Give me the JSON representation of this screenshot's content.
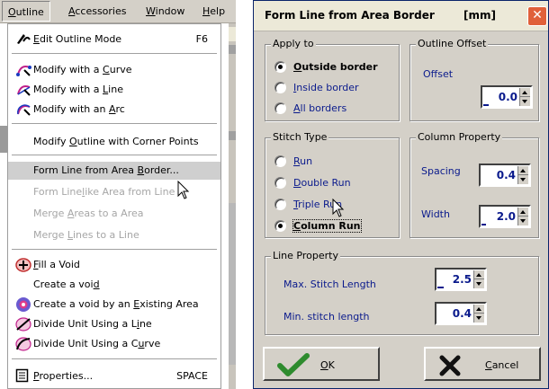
{
  "menubar": {
    "items": [
      {
        "label": "Outline",
        "ul": "O",
        "rest": "utline",
        "active": true
      },
      {
        "label": "Accessories",
        "ul": "A",
        "rest": "ccessories"
      },
      {
        "label": "Window",
        "ul": "W",
        "rest": "indow"
      },
      {
        "label": "Help",
        "ul": "H",
        "rest": "elp"
      }
    ]
  },
  "menu": {
    "edit_mode": {
      "pre": "",
      "ul": "E",
      "post": "dit Outline Mode",
      "shortcut": "F6",
      "icon": "edit-outline-icon"
    },
    "modify_curve": {
      "pre": "Modify with a ",
      "ul": "C",
      "post": "urve",
      "icon": "curve-modify-icon"
    },
    "modify_line": {
      "pre": "Modify with a ",
      "ul": "L",
      "post": "ine",
      "icon": "line-modify-icon"
    },
    "modify_arc": {
      "pre": "Modify with an ",
      "ul": "A",
      "post": "rc",
      "icon": "arc-modify-icon"
    },
    "modify_corner": {
      "pre": "Modify ",
      "ul": "O",
      "post": "utline with Corner Points"
    },
    "form_line": {
      "pre": "Form Line from Area ",
      "ul": "B",
      "post": "order..."
    },
    "form_linelike": {
      "pre": "Form Line",
      "ul": "l",
      "post": "ike Area from Line"
    },
    "merge_areas": {
      "pre": "Merge ",
      "ul": "A",
      "post": "reas to a Area"
    },
    "merge_lines": {
      "pre": "Merge ",
      "ul": "L",
      "post": "ines to a Line"
    },
    "fill_void": {
      "pre": "",
      "ul": "F",
      "post": "ill a Void",
      "icon": "fill-void-icon"
    },
    "create_void": {
      "pre": "Create a voi",
      "ul": "d",
      "post": ""
    },
    "create_void_existing": {
      "pre": "Create a void by an ",
      "ul": "E",
      "post": "xisting Area",
      "icon": "void-existing-area-icon"
    },
    "divide_line": {
      "pre": "Divide Unit Using a L",
      "ul": "i",
      "post": "ne",
      "icon": "divide-line-icon"
    },
    "divide_curve": {
      "pre": "Divide Unit Using a C",
      "ul": "u",
      "post": "rve",
      "icon": "divide-curve-icon"
    },
    "properties": {
      "pre": "",
      "ul": "P",
      "post": "roperties...",
      "shortcut": "SPACE",
      "icon": "properties-icon"
    }
  },
  "dialog": {
    "title": "Form Line from Area Border",
    "unit": "[mm]",
    "close_glyph": "✕",
    "apply_to": {
      "legend": "Apply to",
      "options": [
        {
          "pre": "",
          "ul": "O",
          "post": "utside border",
          "selected": true
        },
        {
          "pre": "",
          "ul": "I",
          "post": "nside border",
          "selected": false
        },
        {
          "pre": "",
          "ul": "A",
          "post": "ll borders",
          "selected": false
        }
      ]
    },
    "outline_offset": {
      "legend": "Outline Offset",
      "offset_label": "Offset",
      "offset_value": "0.0"
    },
    "stitch_type": {
      "legend": "Stitch Type",
      "options": [
        {
          "pre": "",
          "ul": "R",
          "post": "un",
          "selected": false
        },
        {
          "pre": "",
          "ul": "D",
          "post": "ouble Run",
          "selected": false
        },
        {
          "pre": "",
          "ul": "T",
          "post": "riple Run",
          "selected": false
        },
        {
          "pre": "",
          "ul": "C",
          "post": "olumn Run",
          "selected": true
        }
      ]
    },
    "column_property": {
      "legend": "Column Property",
      "spacing_label": "Spacing",
      "spacing_value": "0.4",
      "width_label": "Width",
      "width_value": "2.0"
    },
    "line_property": {
      "legend": "Line Property",
      "max_label": "Max. Stitch Length",
      "max_value": "2.5",
      "min_label": "Min. stitch length",
      "min_value": "0.4"
    },
    "ok_button": {
      "pre": "",
      "ul": "O",
      "post": "K",
      "icon": "checkmark-icon"
    },
    "cancel_button": {
      "pre": "",
      "ul": "C",
      "post": "ancel",
      "icon": "cross-icon"
    }
  }
}
